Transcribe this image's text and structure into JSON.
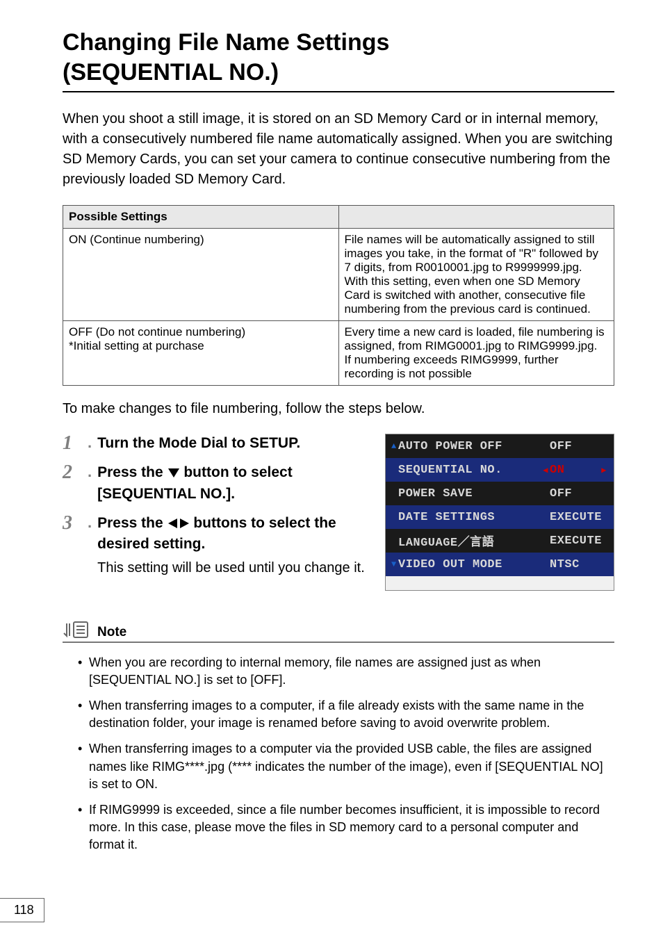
{
  "title_line1": "Changing File Name Settings",
  "title_line2": "(SEQUENTIAL NO.)",
  "intro": "When you shoot a still image, it is stored on an SD Memory Card or in internal memory, with a consecutively numbered file name automatically assigned. When you are switching SD Memory Cards, you can set your camera to continue consecutive numbering from the previously loaded SD Memory Card.",
  "table": {
    "header": "Possible Settings",
    "rows": [
      {
        "label": "ON (Continue numbering)",
        "desc": "File names will be automatically assigned to still images you take, in the format of \"R\" followed by 7 digits, from R0010001.jpg to R9999999.jpg.\nWith this setting, even when one SD Memory Card is switched with another, consecutive file numbering from the previous card is continued."
      },
      {
        "label": "OFF (Do not continue numbering)\n*Initial setting at purchase",
        "desc": "Every time a new card is loaded, file numbering is assigned, from RIMG0001.jpg to RIMG9999.jpg.\nIf numbering exceeds RIMG9999, further recording is not possible"
      }
    ]
  },
  "after_table": "To make changes to file numbering, follow the steps below.",
  "steps": [
    {
      "n": "1",
      "main_pre": "Turn the Mode Dial to ",
      "main_bold": "SETUP",
      "main_post": ".",
      "sub": ""
    },
    {
      "n": "2",
      "main_pre": "Press the ",
      "icon": "down",
      "main_post": " button to select [SEQUENTIAL NO.].",
      "sub": ""
    },
    {
      "n": "3",
      "main_pre": "Press the ",
      "icon": "lr",
      "main_post": " buttons to select the desired setting.",
      "sub": "This setting will be used until you change it."
    }
  ],
  "menu": {
    "rows": [
      {
        "label": "AUTO POWER OFF",
        "value": "OFF",
        "bg": "dark",
        "selected": false,
        "ud": "up"
      },
      {
        "label": "SEQUENTIAL NO.",
        "value": "ON",
        "bg": "blue",
        "selected": true
      },
      {
        "label": "POWER SAVE",
        "value": "OFF",
        "bg": "dark",
        "selected": false
      },
      {
        "label": "DATE SETTINGS",
        "value": "EXECUTE",
        "bg": "blue",
        "selected": false
      },
      {
        "label": "LANGUAGE／言語",
        "value": "EXECUTE",
        "bg": "dark",
        "selected": false
      },
      {
        "label": "VIDEO OUT MODE",
        "value": "NTSC",
        "bg": "blue",
        "selected": false,
        "ud": "down"
      }
    ]
  },
  "note_label": "Note",
  "notes": [
    "When you are recording to internal memory, file names are assigned just as when [SEQUENTIAL NO.] is set to [OFF].",
    "When transferring images to a computer, if a file already exists with the same name in the destination folder, your image is renamed before saving to avoid overwrite problem.",
    "When transferring images to a computer via the provided USB cable, the files are assigned names like RIMG****.jpg (**** indicates the number of the image), even if [SEQUENTIAL NO] is set to ON.",
    "If RIMG9999 is exceeded, since a file number becomes insufficient, it is impossible to record more. In this case, please move the files in SD memory card to a personal computer and format it."
  ],
  "page_number": "118"
}
